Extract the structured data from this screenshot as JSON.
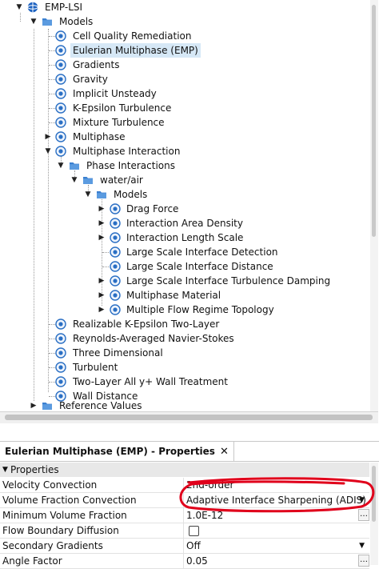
{
  "tree": {
    "root": "EMP-LSI",
    "models": "Models",
    "items": [
      "Cell Quality Remediation",
      "Eulerian Multiphase (EMP)",
      "Gradients",
      "Gravity",
      "Implicit Unsteady",
      "K-Epsilon Turbulence",
      "Mixture Turbulence",
      "Multiphase",
      "Multiphase Interaction"
    ],
    "phase_interactions": "Phase Interactions",
    "water_air": "water/air",
    "sub_models": "Models",
    "sub_items": [
      "Drag Force",
      "Interaction Area Density",
      "Interaction Length Scale",
      "Large Scale Interface Detection",
      "Large Scale Interface Distance",
      "Large Scale Interface Turbulence Damping",
      "Multiphase Material",
      "Multiple Flow Regime Topology"
    ],
    "more_items": [
      "Realizable K-Epsilon Two-Layer",
      "Reynolds-Averaged Navier-Stokes",
      "Three Dimensional",
      "Turbulent",
      "Two-Layer All y+ Wall Treatment",
      "Wall Distance"
    ],
    "reference_values": "Reference Values"
  },
  "properties": {
    "title": "Eulerian Multiphase (EMP) - Properties",
    "close": "✕",
    "section": "Properties",
    "rows": [
      {
        "key": "Velocity Convection",
        "value": "2nd-order"
      },
      {
        "key": "Volume Fraction Convection",
        "value": "Adaptive Interface Sharpening (ADIS)"
      },
      {
        "key": "Minimum Volume Fraction",
        "value": "1.0E-12"
      },
      {
        "key": "Flow Boundary Diffusion",
        "value": ""
      },
      {
        "key": "Secondary Gradients",
        "value": "Off"
      },
      {
        "key": "Angle Factor",
        "value": "0.05"
      }
    ]
  },
  "colors": {
    "folder": "#3a7fd0",
    "model_icon": "#2a6fc4",
    "annotation": "#e0001b",
    "selection": "#d6e8f6"
  },
  "icons": {
    "expanded": "chevron-down-icon",
    "collapsed": "chevron-right-icon",
    "model": "model-node-icon",
    "folder": "folder-icon"
  }
}
